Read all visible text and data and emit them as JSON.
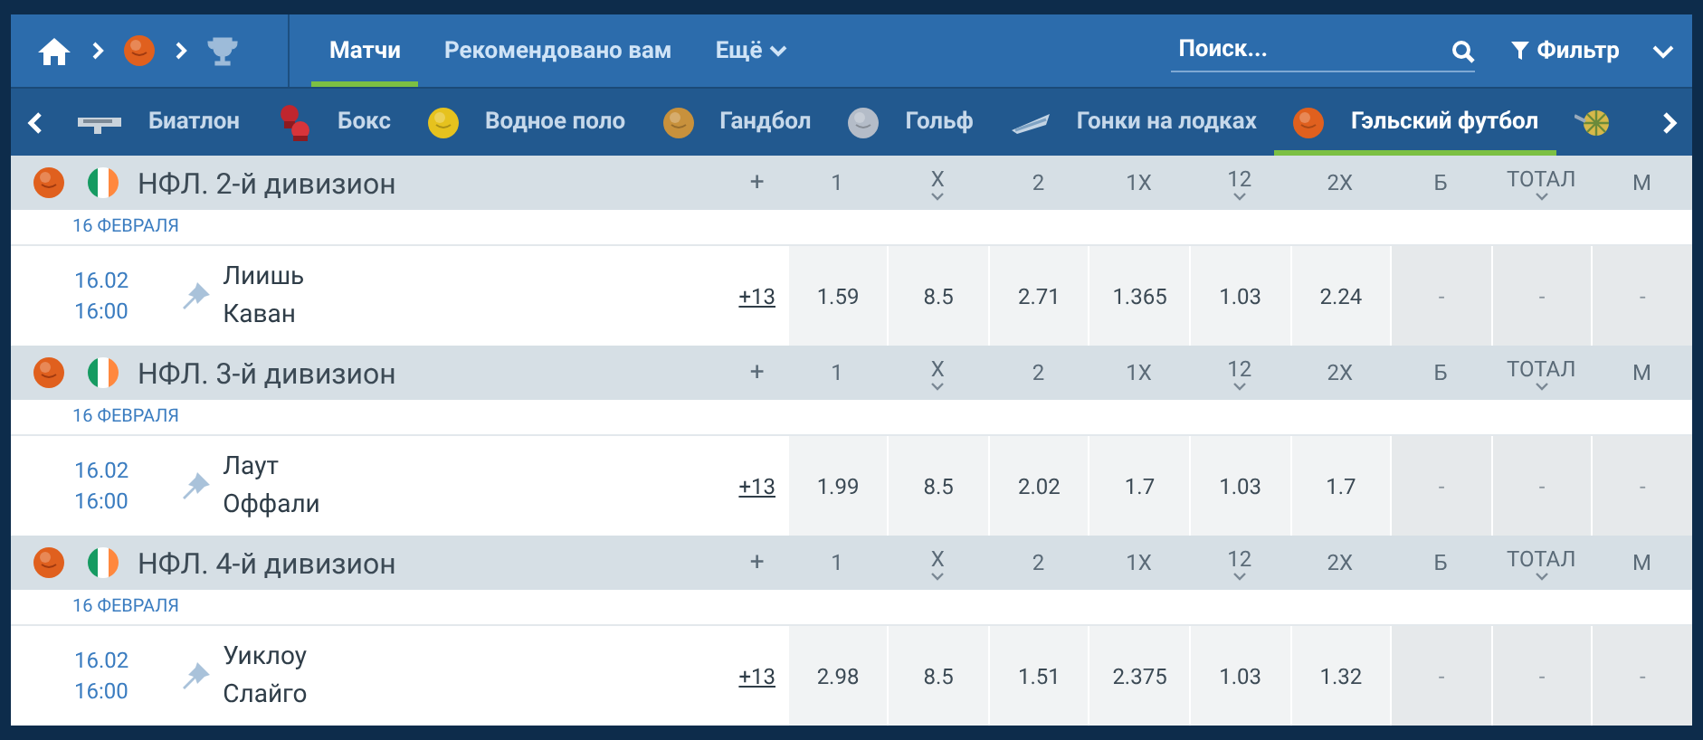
{
  "tabs": [
    {
      "label": "Матчи",
      "selected": true,
      "dropdown": false
    },
    {
      "label": "Рекомендовано вам",
      "selected": false,
      "dropdown": false
    },
    {
      "label": "Ещё",
      "selected": false,
      "dropdown": true
    }
  ],
  "search": {
    "placeholder": "Поиск..."
  },
  "filter": {
    "label": "Фильтр"
  },
  "sports": [
    {
      "label": "Биатлон",
      "kind": "rifle",
      "selected": false
    },
    {
      "label": "Бокс",
      "kind": "gloves",
      "selected": false
    },
    {
      "label": "Водное поло",
      "kind": "ball",
      "color": "#e6c21e",
      "selected": false
    },
    {
      "label": "Гандбол",
      "kind": "ball",
      "color": "#c8913c",
      "selected": false
    },
    {
      "label": "Гольф",
      "kind": "ball",
      "color": "#b4bcc8",
      "selected": false
    },
    {
      "label": "Гонки на лодках",
      "kind": "boat",
      "selected": false
    },
    {
      "label": "Гэльский футбол",
      "kind": "ball",
      "color": "#e0601e",
      "selected": true
    },
    {
      "kind": "darts",
      "selected": false
    }
  ],
  "leagues": [
    {
      "name": "НФЛ. 2-й дивизион",
      "columns": [
        {
          "label": "+",
          "expandable": false
        },
        {
          "label": "1",
          "expandable": false
        },
        {
          "label": "X",
          "expandable": true
        },
        {
          "label": "2",
          "expandable": false
        },
        {
          "label": "1X",
          "expandable": false
        },
        {
          "label": "12",
          "expandable": true
        },
        {
          "label": "2X",
          "expandable": false
        },
        {
          "label": "Б",
          "expandable": false
        },
        {
          "label": "ТОТАЛ",
          "expandable": true
        },
        {
          "label": "М",
          "expandable": false
        }
      ],
      "date": "16 ФЕВРАЛЯ",
      "matches": [
        {
          "date": "16.02",
          "time": "16:00",
          "home": "Лиишь",
          "away": "Каван",
          "more": "+13",
          "odds": [
            {
              "value": "1.59",
              "available": true
            },
            {
              "value": "8.5",
              "available": true
            },
            {
              "value": "2.71",
              "available": true
            },
            {
              "value": "1.365",
              "available": true
            },
            {
              "value": "1.03",
              "available": true
            },
            {
              "value": "2.24",
              "available": true
            },
            {
              "value": "-",
              "available": false
            },
            {
              "value": "-",
              "available": false
            },
            {
              "value": "-",
              "available": false
            }
          ]
        }
      ]
    },
    {
      "name": "НФЛ. 3-й дивизион",
      "columns": [
        {
          "label": "+",
          "expandable": false
        },
        {
          "label": "1",
          "expandable": false
        },
        {
          "label": "X",
          "expandable": true
        },
        {
          "label": "2",
          "expandable": false
        },
        {
          "label": "1X",
          "expandable": false
        },
        {
          "label": "12",
          "expandable": true
        },
        {
          "label": "2X",
          "expandable": false
        },
        {
          "label": "Б",
          "expandable": false
        },
        {
          "label": "ТОТАЛ",
          "expandable": true
        },
        {
          "label": "М",
          "expandable": false
        }
      ],
      "date": "16 ФЕВРАЛЯ",
      "matches": [
        {
          "date": "16.02",
          "time": "16:00",
          "home": "Лаут",
          "away": "Оффали",
          "more": "+13",
          "odds": [
            {
              "value": "1.99",
              "available": true
            },
            {
              "value": "8.5",
              "available": true
            },
            {
              "value": "2.02",
              "available": true
            },
            {
              "value": "1.7",
              "available": true
            },
            {
              "value": "1.03",
              "available": true
            },
            {
              "value": "1.7",
              "available": true
            },
            {
              "value": "-",
              "available": false
            },
            {
              "value": "-",
              "available": false
            },
            {
              "value": "-",
              "available": false
            }
          ]
        }
      ]
    },
    {
      "name": "НФЛ. 4-й дивизион",
      "columns": [
        {
          "label": "+",
          "expandable": false
        },
        {
          "label": "1",
          "expandable": false
        },
        {
          "label": "X",
          "expandable": true
        },
        {
          "label": "2",
          "expandable": false
        },
        {
          "label": "1X",
          "expandable": false
        },
        {
          "label": "12",
          "expandable": true
        },
        {
          "label": "2X",
          "expandable": false
        },
        {
          "label": "Б",
          "expandable": false
        },
        {
          "label": "ТОТАЛ",
          "expandable": true
        },
        {
          "label": "М",
          "expandable": false
        }
      ],
      "date": "16 ФЕВРАЛЯ",
      "matches": [
        {
          "date": "16.02",
          "time": "16:00",
          "home": "Уиклоу",
          "away": "Слайго",
          "more": "+13",
          "odds": [
            {
              "value": "2.98",
              "available": true
            },
            {
              "value": "8.5",
              "available": true
            },
            {
              "value": "1.51",
              "available": true
            },
            {
              "value": "2.375",
              "available": true
            },
            {
              "value": "1.03",
              "available": true
            },
            {
              "value": "1.32",
              "available": true
            },
            {
              "value": "-",
              "available": false
            },
            {
              "value": "-",
              "available": false
            },
            {
              "value": "-",
              "available": false
            }
          ]
        }
      ]
    }
  ]
}
